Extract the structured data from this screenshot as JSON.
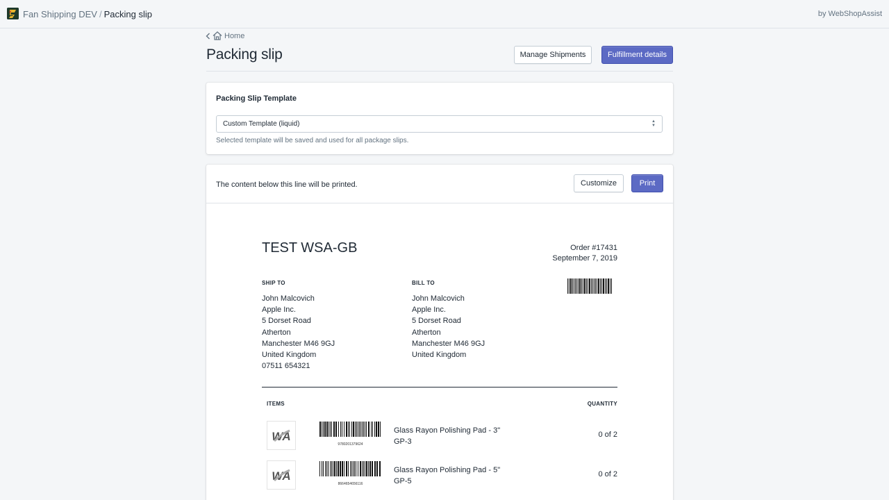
{
  "topbar": {
    "app_name": "Fan Shipping DEV",
    "separator": "/",
    "current_page": "Packing slip",
    "vendor": "by WebShopAssist"
  },
  "breadcrumb": {
    "back_label": "Home"
  },
  "page": {
    "title": "Packing slip",
    "manage_label": "Manage Shipments",
    "fulfillment_label": "Fulfillment details"
  },
  "template_card": {
    "heading": "Packing Slip Template",
    "selected": "Custom Template (liquid)",
    "help": "Selected template will be saved and used for all package slips."
  },
  "print_card": {
    "notice": "The content below this line will be printed.",
    "customize_label": "Customize",
    "print_label": "Print"
  },
  "slip": {
    "shop_name": "TEST WSA-GB",
    "order_number": "Order #17431",
    "order_date": "September 7, 2019",
    "ship_to_label": "SHIP TO",
    "bill_to_label": "BILL TO",
    "ship_to": [
      "John Malcovich",
      "Apple Inc.",
      "5 Dorset Road",
      "Atherton",
      "Manchester M46 9GJ",
      "United Kingdom",
      "07511 654321"
    ],
    "bill_to": [
      "John Malcovich",
      "Apple Inc.",
      "5 Dorset Road",
      "Atherton",
      "Manchester M46 9GJ",
      "United Kingdom"
    ],
    "items_label": "ITEMS",
    "quantity_label": "QUANTITY",
    "items": [
      {
        "name": "Glass Rayon Polishing Pad - 3\"",
        "sku": "GP-3",
        "barcode": "9780201379624",
        "quantity": "0 of 2"
      },
      {
        "name": "Glass Rayon Polishing Pad - 5\"",
        "sku": "GP-5",
        "barcode": "8664654656116",
        "quantity": "0 of 2"
      }
    ]
  },
  "colors": {
    "primary": "#5c6ac4",
    "text": "#212b36",
    "subdued": "#637381",
    "background": "#f4f6f8"
  },
  "icons": [
    "app-logo-icon",
    "chevron-left-icon",
    "home-icon",
    "select-arrows-icon",
    "barcode-icon",
    "product-thumbnail"
  ]
}
